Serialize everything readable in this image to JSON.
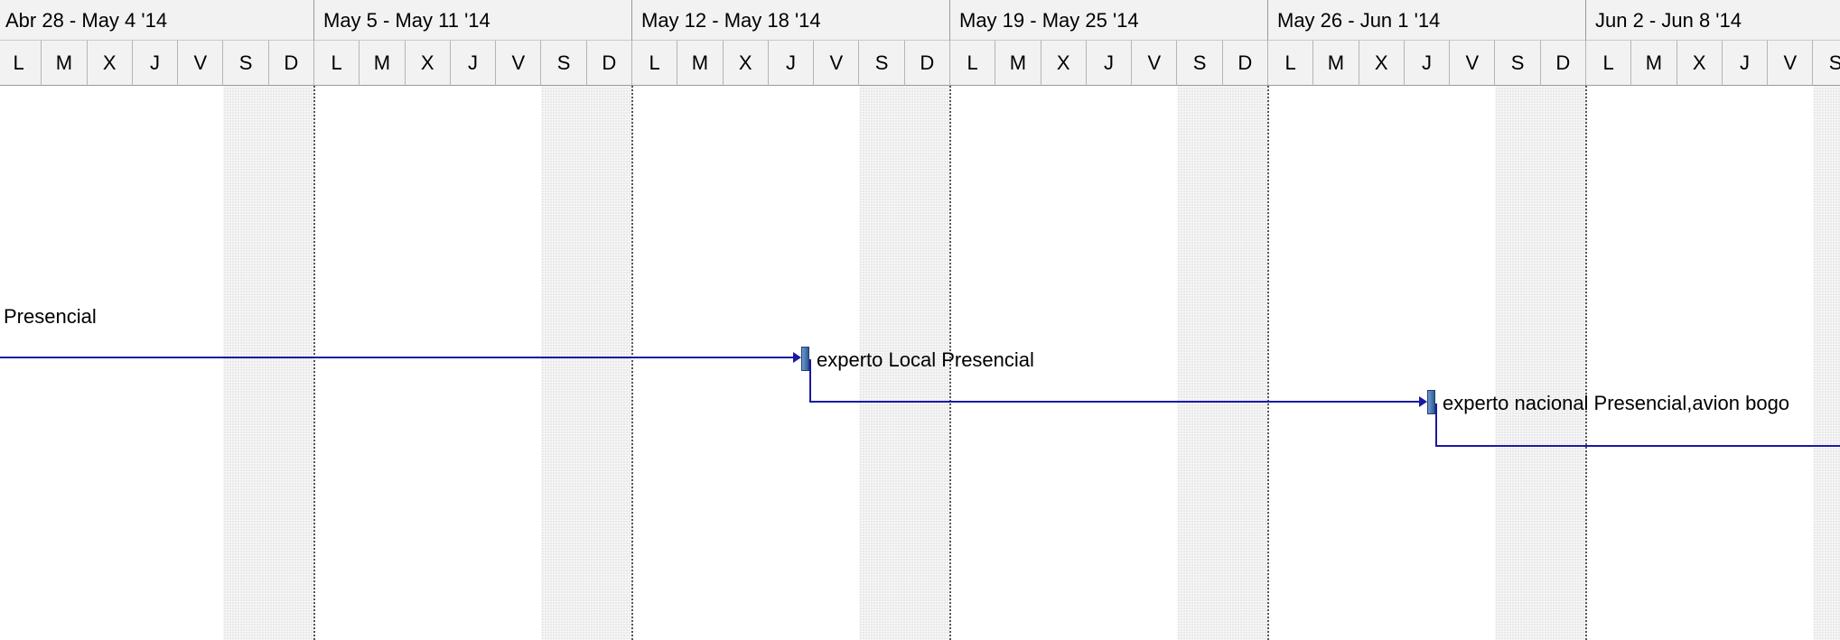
{
  "weeks": [
    "Abr 28 - May 4 '14",
    "May 5 - May 11 '14",
    "May 12 - May 18 '14",
    "May 19 - May 25 '14",
    "May 26 - Jun 1 '14",
    "Jun 2 - Jun 8 '14"
  ],
  "days": [
    "L",
    "M",
    "X",
    "J",
    "V",
    "S",
    "D"
  ],
  "tasks": [
    {
      "label": "Presencial"
    },
    {
      "label": "experto Local Presencial"
    },
    {
      "label": "experto nacional Presencial,avion bogo"
    }
  ],
  "colors": {
    "header_bg": "#f2f2f2",
    "link_line": "#1a1aa0",
    "milestone": "#4a78b0",
    "weekend": "#e9e9e9"
  }
}
